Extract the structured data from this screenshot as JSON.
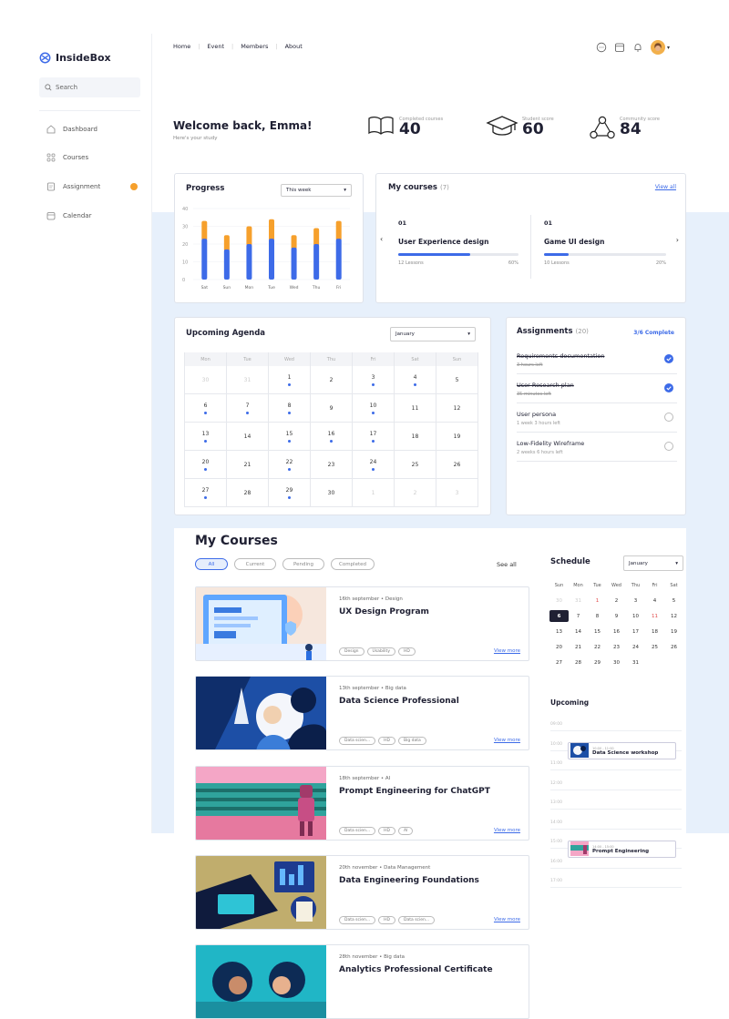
{
  "app": {
    "name": "InsideBox"
  },
  "search": {
    "placeholder": "Search"
  },
  "sidebar": {
    "items": [
      {
        "label": "Dashboard",
        "icon": "home-icon"
      },
      {
        "label": "Courses",
        "icon": "grid-icon"
      },
      {
        "label": "Assignment",
        "icon": "document-icon",
        "badge": true
      },
      {
        "label": "Calendar",
        "icon": "calendar-icon"
      }
    ]
  },
  "topnav": {
    "items": [
      "Home",
      "Event",
      "Members",
      "About"
    ]
  },
  "welcome": {
    "title": "Welcome back, Emma!",
    "subtitle": "Here's your study"
  },
  "stats": [
    {
      "label": "Completed courses",
      "value": "40",
      "icon": "book-icon"
    },
    {
      "label": "Student score",
      "value": "60",
      "icon": "graduation-cap-icon"
    },
    {
      "label": "Community score",
      "value": "84",
      "icon": "community-icon"
    }
  ],
  "progress": {
    "title": "Progress",
    "period": "This week",
    "chart_data": {
      "type": "bar",
      "categories": [
        "Sat",
        "Sun",
        "Mon",
        "Tue",
        "Wed",
        "Thu",
        "Fri"
      ],
      "series": [
        {
          "values": [
            23,
            17,
            20,
            23,
            18,
            20,
            23
          ],
          "color": "#3d6be8"
        },
        {
          "values": [
            10,
            8,
            10,
            11,
            7,
            9,
            10
          ],
          "color": "#f6a02c"
        }
      ],
      "yticks": [
        "0",
        "10",
        "20",
        "30",
        "40"
      ],
      "ylim": [
        0,
        40
      ]
    }
  },
  "my_courses_top": {
    "title": "My courses",
    "count": "(7)",
    "view_all": "View all",
    "items": [
      {
        "index": "01",
        "name": "User Experience design",
        "lessons": "12 Lessons",
        "percent": "60%",
        "progress": 0.6
      },
      {
        "index": "01",
        "name": "Game UI design",
        "lessons": "10 Lessons",
        "percent": "20%",
        "progress": 0.2
      }
    ]
  },
  "agenda": {
    "title": "Upcoming Agenda",
    "month": "January",
    "weekdays": [
      "Mon",
      "Tue",
      "Wed",
      "Thu",
      "Fri",
      "Sat",
      "Sun"
    ],
    "days": [
      {
        "d": "30",
        "dim": true
      },
      {
        "d": "31",
        "dim": true
      },
      {
        "d": "1",
        "dot": true
      },
      {
        "d": "2"
      },
      {
        "d": "3",
        "dot": true
      },
      {
        "d": "4",
        "dot": true
      },
      {
        "d": "5"
      },
      {
        "d": "6",
        "dot": true
      },
      {
        "d": "7",
        "dot": true
      },
      {
        "d": "8",
        "dot": true
      },
      {
        "d": "9"
      },
      {
        "d": "10",
        "dot": true
      },
      {
        "d": "11"
      },
      {
        "d": "12"
      },
      {
        "d": "13",
        "dot": true
      },
      {
        "d": "14"
      },
      {
        "d": "15",
        "dot": true
      },
      {
        "d": "16",
        "dot": true
      },
      {
        "d": "17",
        "dot": true
      },
      {
        "d": "18"
      },
      {
        "d": "19"
      },
      {
        "d": "20",
        "dot": true
      },
      {
        "d": "21"
      },
      {
        "d": "22",
        "dot": true
      },
      {
        "d": "23"
      },
      {
        "d": "24",
        "dot": true
      },
      {
        "d": "25"
      },
      {
        "d": "26"
      },
      {
        "d": "27",
        "dot": true
      },
      {
        "d": "28"
      },
      {
        "d": "29",
        "dot": true
      },
      {
        "d": "30"
      },
      {
        "d": "1",
        "dim": true
      },
      {
        "d": "2",
        "dim": true
      },
      {
        "d": "3",
        "dim": true
      }
    ]
  },
  "assignments": {
    "title": "Assignments",
    "count": "(20)",
    "complete": "3/6 Complete",
    "items": [
      {
        "title": "Requirements documentation",
        "time": "3 hours left",
        "done": true
      },
      {
        "title": "User Research plan",
        "time": "35 minutes left",
        "done": true
      },
      {
        "title": "User persona",
        "time": "1 week 3 hours left",
        "done": false
      },
      {
        "title": "Low-Fidelity Wireframe",
        "time": "2 weeks 6 hours left",
        "done": false
      }
    ]
  },
  "courses": {
    "title": "My Courses",
    "filters": [
      "All",
      "Current",
      "Pending",
      "Completed"
    ],
    "see_all": "See all",
    "view_more": "View more",
    "items": [
      {
        "date": "16th september",
        "category": "Design",
        "name": "UX Design Program",
        "tags": [
          "Design",
          "Usability",
          "HD"
        ]
      },
      {
        "date": "13th september",
        "category": "Big data",
        "name": "Data Science Professional",
        "tags": [
          "Data scien...",
          "HD",
          "Big data"
        ]
      },
      {
        "date": "18th september",
        "category": "AI",
        "name": "Prompt Engineering for ChatGPT",
        "tags": [
          "Data scien...",
          "HD",
          "AI"
        ]
      },
      {
        "date": "20th november",
        "category": "Data Management",
        "name": "Data Engineering Foundations",
        "tags": [
          "Data scien...",
          "HD",
          "Data scien..."
        ]
      },
      {
        "date": "28th november",
        "category": "Big data",
        "name": "Analytics Professional Certificate",
        "tags": []
      }
    ]
  },
  "schedule": {
    "title": "Schedule",
    "month": "January",
    "weekdays": [
      "Sun",
      "Mon",
      "Tue",
      "Wed",
      "Thu",
      "Fri",
      "Sat"
    ],
    "days": [
      {
        "d": "30",
        "dim": true
      },
      {
        "d": "31",
        "dim": true
      },
      {
        "d": "1",
        "red": true
      },
      {
        "d": "2"
      },
      {
        "d": "3"
      },
      {
        "d": "4"
      },
      {
        "d": "5"
      },
      {
        "d": "6",
        "sel": true
      },
      {
        "d": "7"
      },
      {
        "d": "8"
      },
      {
        "d": "9"
      },
      {
        "d": "10"
      },
      {
        "d": "11",
        "red": true
      },
      {
        "d": "12"
      },
      {
        "d": "13"
      },
      {
        "d": "14"
      },
      {
        "d": "15"
      },
      {
        "d": "16"
      },
      {
        "d": "17"
      },
      {
        "d": "18"
      },
      {
        "d": "19"
      },
      {
        "d": "20"
      },
      {
        "d": "21"
      },
      {
        "d": "22"
      },
      {
        "d": "23"
      },
      {
        "d": "24"
      },
      {
        "d": "25"
      },
      {
        "d": "26"
      },
      {
        "d": "27"
      },
      {
        "d": "28"
      },
      {
        "d": "29"
      },
      {
        "d": "30"
      },
      {
        "d": "31"
      }
    ],
    "upcoming_title": "Upcoming",
    "times": [
      "09:00",
      "10:00",
      "11:00",
      "12:00",
      "13:00",
      "14:00",
      "15:00",
      "16:00",
      "17:00"
    ],
    "events": [
      {
        "time": "10:00 - 11:00",
        "name": "Data Science workshop"
      },
      {
        "time": "14:00 - 15:00",
        "name": "Prompt Engineering"
      }
    ]
  }
}
